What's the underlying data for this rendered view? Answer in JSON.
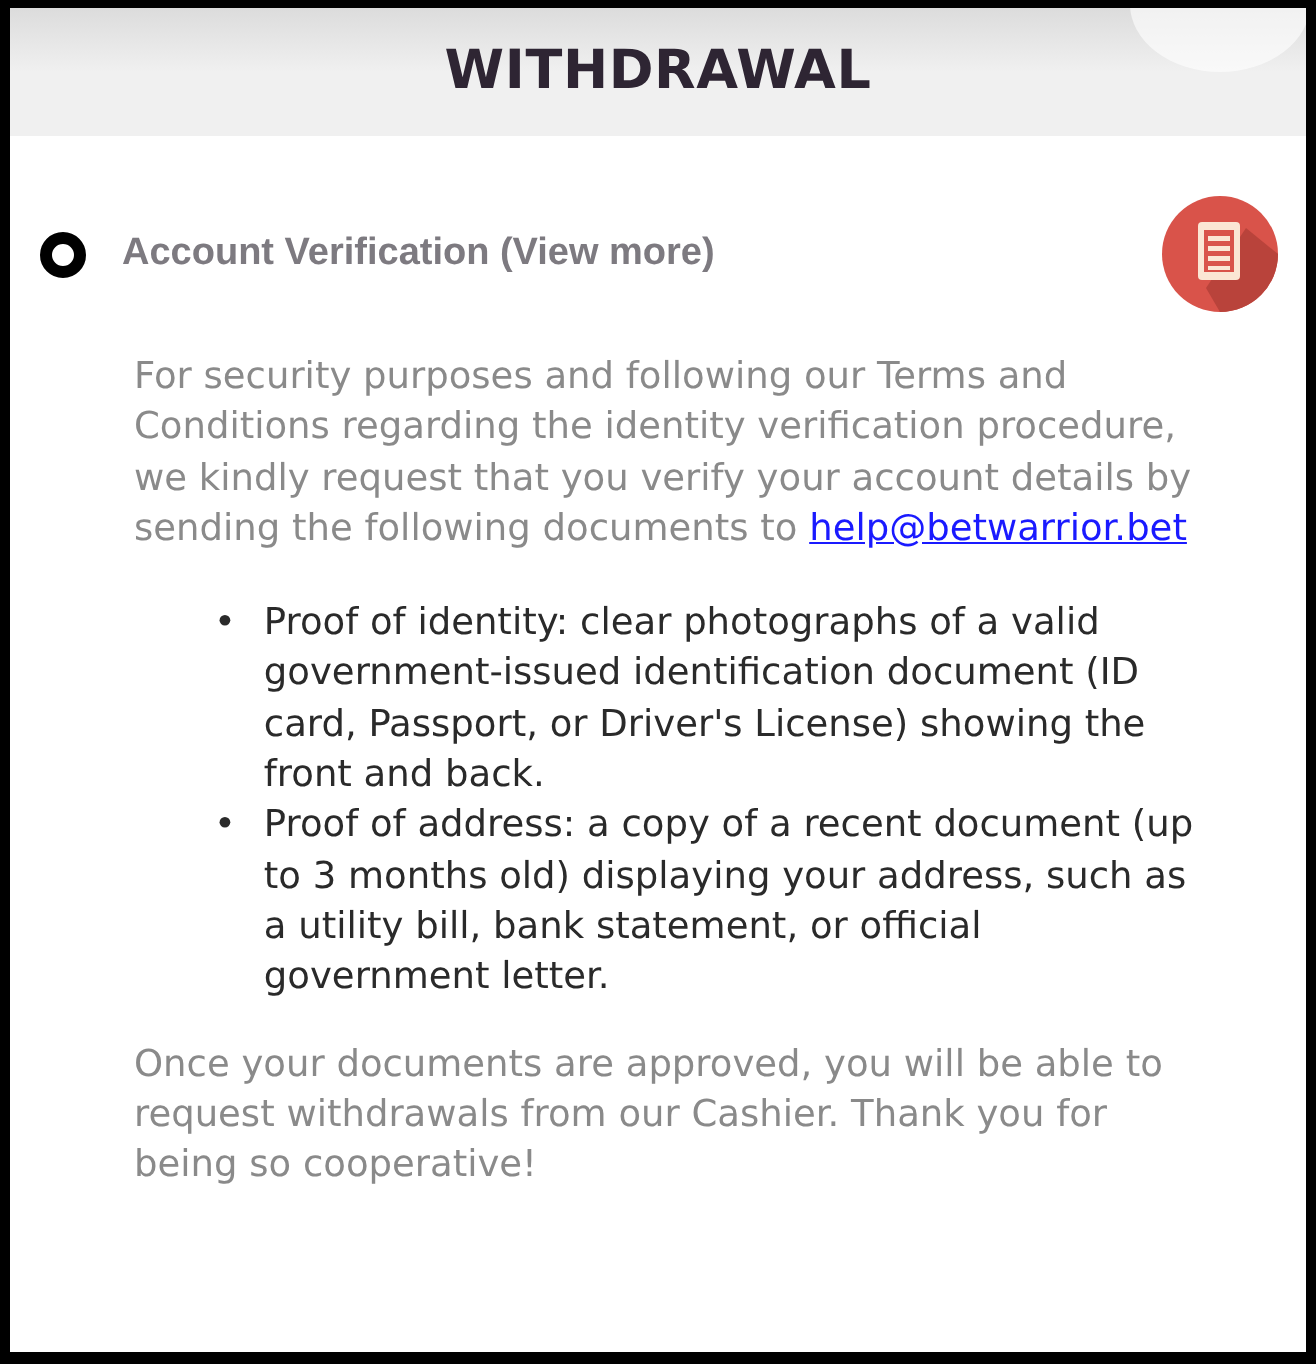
{
  "header": {
    "title": "WITHDRAWAL"
  },
  "section": {
    "title": "Account Verification (View more)",
    "selected": true
  },
  "intro": {
    "text": "For security purposes and following our Terms and Conditions regarding the identity verification procedure, we kindly request that you verify your account details by sending the following documents to ",
    "link": "help@betwarrior.bet"
  },
  "requirements": [
    {
      "marker": "•",
      "text": "Proof of identity: clear photographs of a valid government-issued identification document (ID card, Passport, or Driver's License) showing the front and back."
    },
    {
      "marker": "•",
      "text": "Proof of address: a copy of a recent document (up to 3 months old) displaying your address, such as a utility bill, bank statement, or official government letter."
    }
  ],
  "closing": "Once your documents are approved, you will be able to request withdrawals from our Cashier. Thank you for being so cooperative!"
}
